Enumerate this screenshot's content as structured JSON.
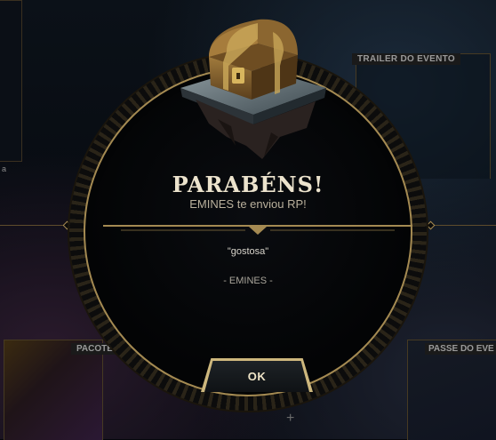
{
  "background": {
    "trailer_label": "TRAILER DO EVENTO",
    "package_label": "PACOTE",
    "pass_label": "PASSE DO EVE",
    "plus_symbol": "+",
    "left_fragments": [
      "a"
    ]
  },
  "dialog": {
    "title": "PARABÉNS!",
    "subtitle": "EMINES te enviou RP!",
    "message": "\"gostosa\"",
    "signature": "- EMINES -",
    "ok_label": "OK"
  },
  "colors": {
    "gold": "#a48a52",
    "gold_light": "#cdb77d",
    "title_text": "#ece3cd",
    "dialog_bg": "#030405"
  },
  "icons": {
    "chest": "treasure-chest-icon"
  }
}
